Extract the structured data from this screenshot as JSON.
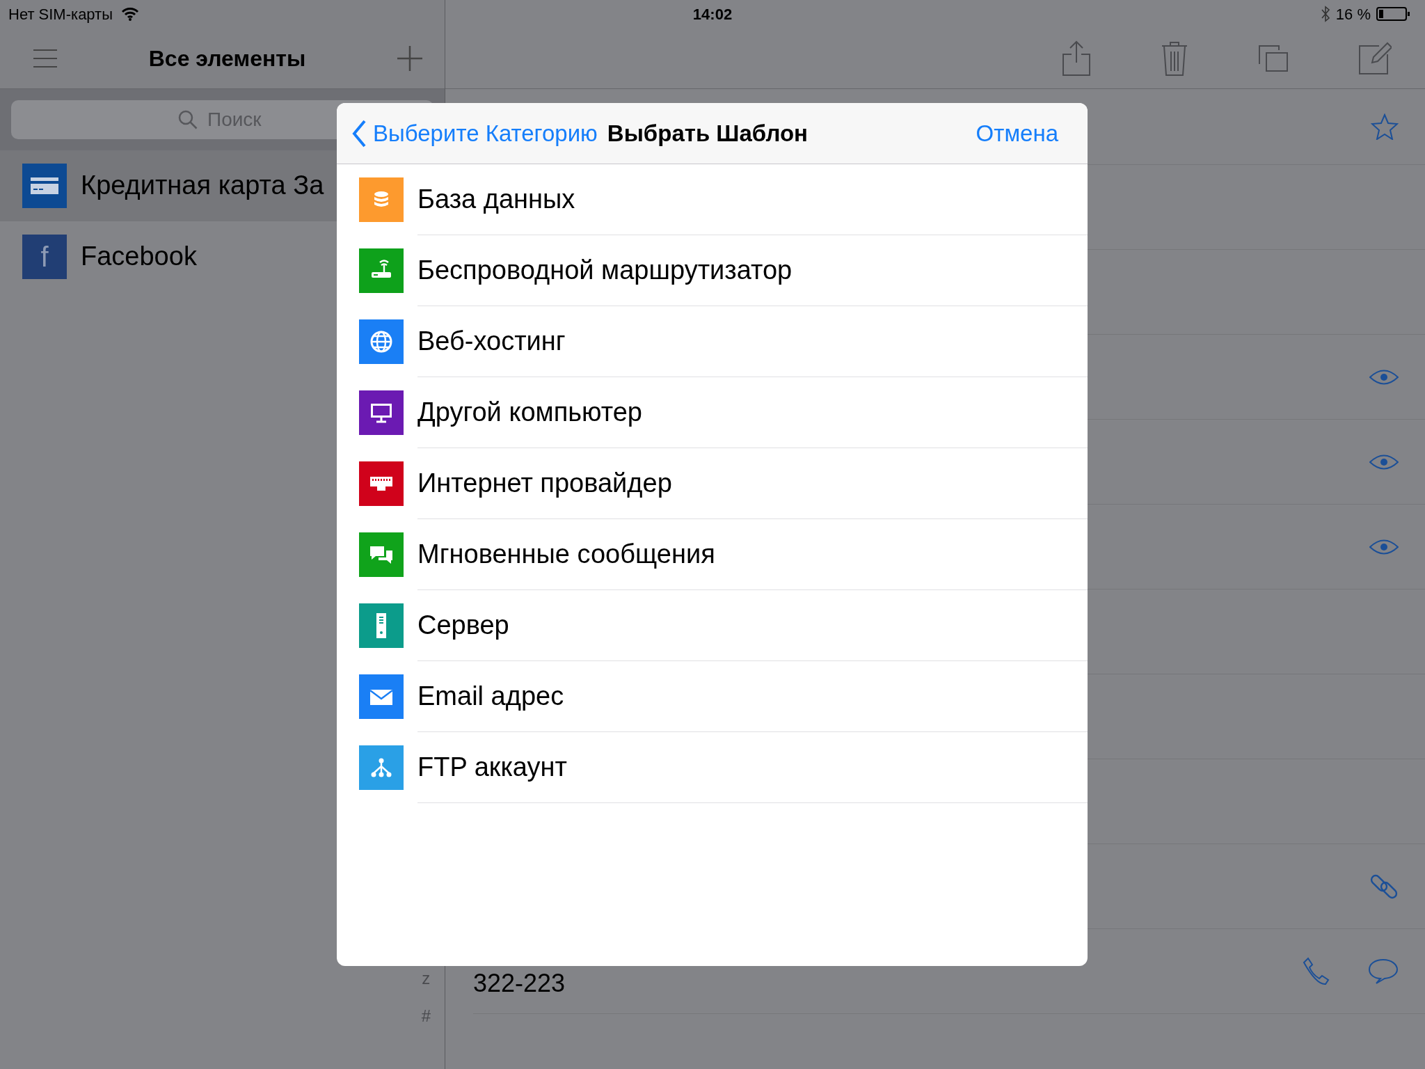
{
  "status_bar": {
    "carrier": "Нет SIM-карты",
    "time": "14:02",
    "battery": "16 %"
  },
  "sidebar": {
    "title": "Все элементы",
    "search": {
      "placeholder": "Поиск"
    },
    "items": [
      {
        "title": "Кредитная карта Зa",
        "kind": "card",
        "selected": true
      },
      {
        "title": "Facebook",
        "kind": "facebook",
        "glyph": "f",
        "selected": false
      }
    ],
    "index_letters": [
      "z",
      "#"
    ]
  },
  "detail": {
    "rows": [
      {
        "kind": "star"
      },
      {
        "kind": "none"
      },
      {
        "kind": "none"
      },
      {
        "kind": "eye"
      },
      {
        "kind": "eye"
      },
      {
        "kind": "eye"
      },
      {
        "kind": "none"
      },
      {
        "kind": "none"
      },
      {
        "kind": "none"
      },
      {
        "kind": "link"
      },
      {
        "kind": "phone",
        "value": "322-223"
      }
    ]
  },
  "modal": {
    "back_label": "Выберите Категорию",
    "title": "Выбрать Шаблон",
    "cancel": "Отмена",
    "templates": [
      {
        "label": "База данных",
        "kind": "database",
        "color": "#fd9a2e"
      },
      {
        "label": "Беспроводной маршрутизатор",
        "kind": "router",
        "color": "#0ea11b"
      },
      {
        "label": "Веб-хостинг",
        "kind": "globe",
        "color": "#1a7ff5"
      },
      {
        "label": "Другой компьютер",
        "kind": "computer",
        "color": "#6b1ab2"
      },
      {
        "label": "Интернет провайдер",
        "kind": "isp",
        "color": "#d0021b"
      },
      {
        "label": "Мгновенные сообщения",
        "kind": "chat",
        "color": "#10a31b"
      },
      {
        "label": "Сервер",
        "kind": "server",
        "color": "#0c9c8b"
      },
      {
        "label": "Email адрес",
        "kind": "email",
        "color": "#1a7ff5"
      },
      {
        "label": "FTP аккаунт",
        "kind": "ftp",
        "color": "#2aa0e6"
      }
    ]
  }
}
